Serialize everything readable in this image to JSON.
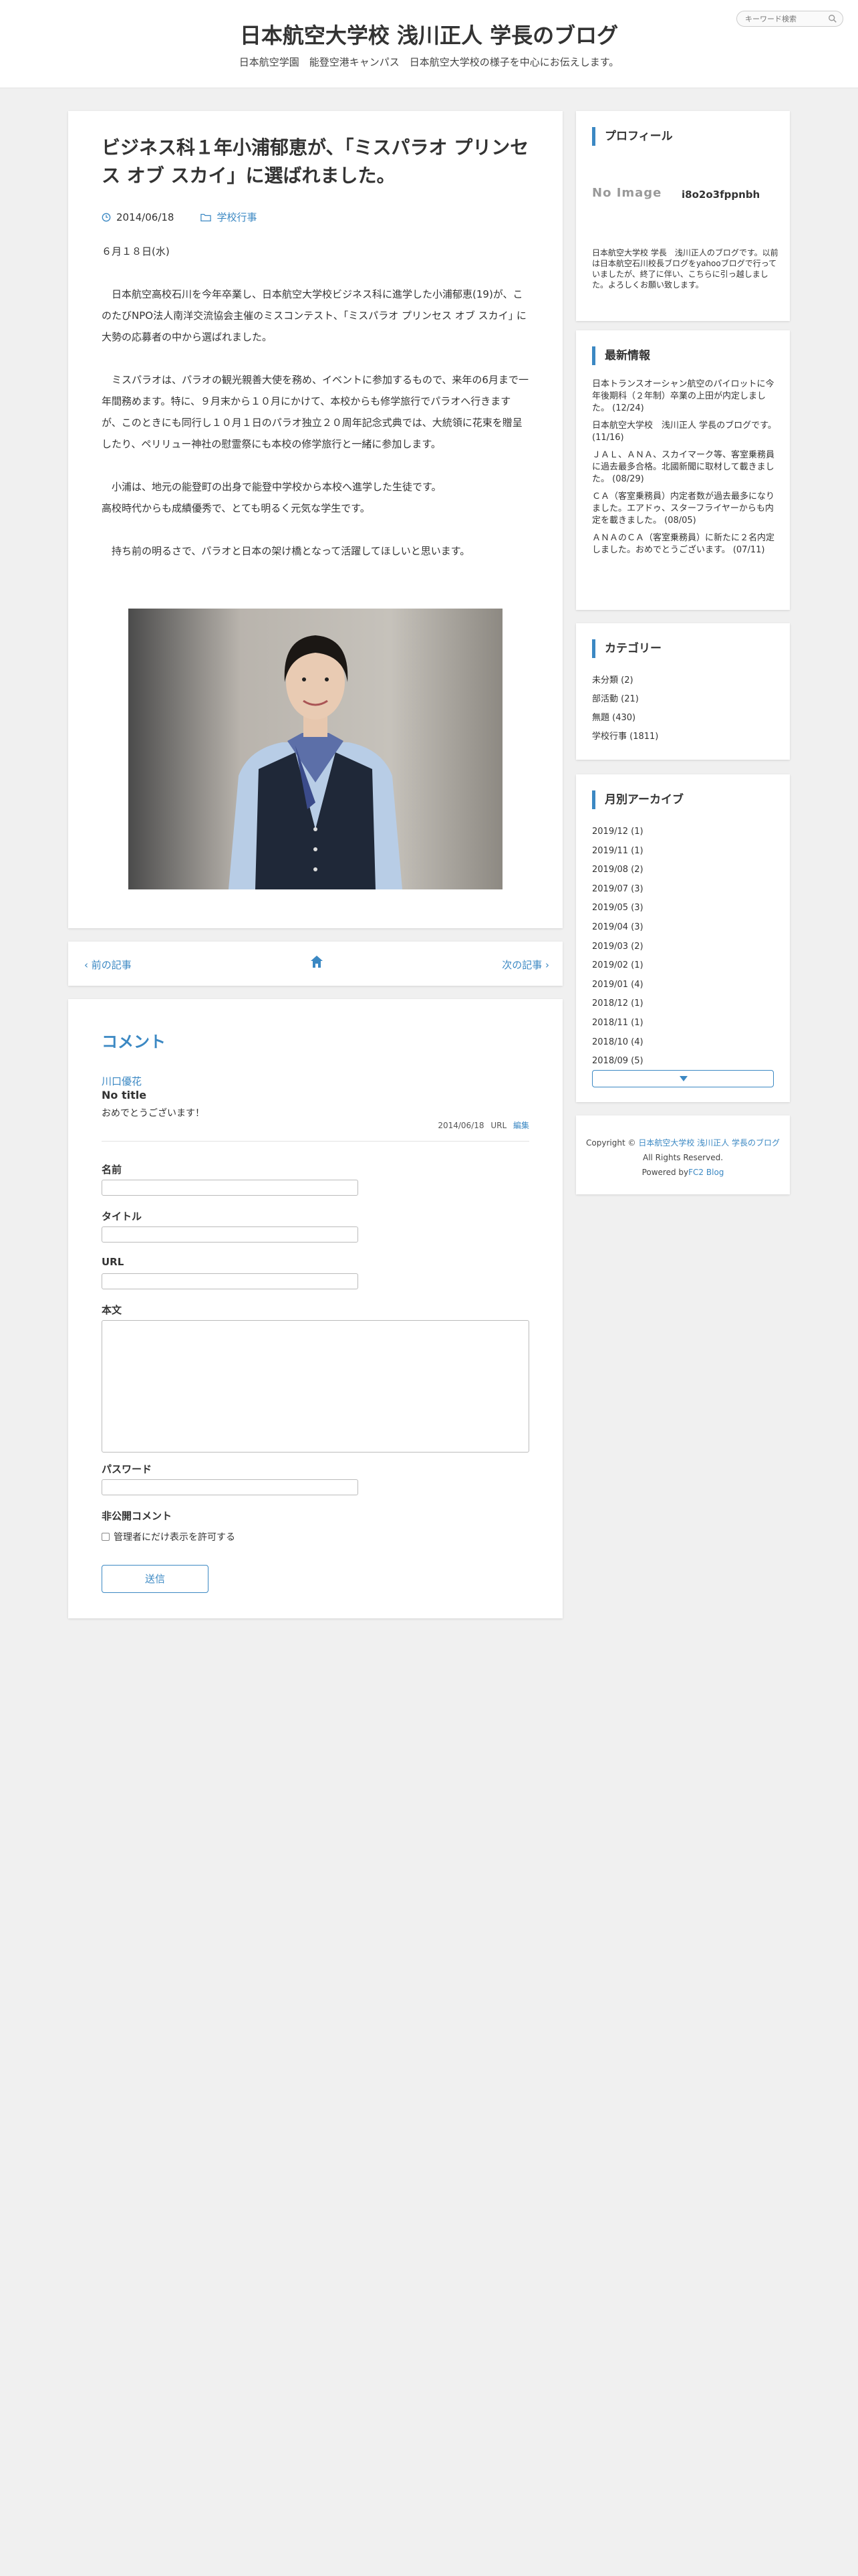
{
  "header": {
    "title": "日本航空大学校 浅川正人 学長のブログ",
    "description": "日本航空学園　能登空港キャンパス　日本航空大学校の様子を中心にお伝えします。",
    "search_placeholder": "キーワード検索"
  },
  "post": {
    "title": "ビジネス科１年小浦郁恵が、「ミスパラオ プリンセス オブ スカイ」に選ばれました。",
    "date": "2014/06/18",
    "category": "学校行事",
    "paragraphs": [
      "６月１８日(水)",
      "",
      "　日本航空高校石川を今年卒業し、日本航空大学校ビジネス科に進学した小浦郁恵(19)が、このたびNPO法人南洋交流協会主催のミスコンテスト、｢ミスパラオ プリンセス オブ スカイ｣ に大勢の応募者の中から選ばれました。",
      "",
      "　ミスパラオは、パラオの観光親善大使を務め、イベントに参加するもので、来年の6月まで一年間務めます。特に、９月末から１０月にかけて、本校からも修学旅行でパラオへ行きますが、このときにも同行し１０月１日のパラオ独立２０周年記念式典では、大統領に花束を贈呈したり、ペリリュー神社の慰霊祭にも本校の修学旅行と一緒に参加します。",
      "",
      "　小浦は、地元の能登町の出身で能登中学校から本校へ進学した生徒です。",
      "高校時代からも成績優秀で、とても明るく元気な学生です。",
      "",
      "　持ち前の明るさで、パラオと日本の架け橋となって活躍してほしいと思います。"
    ]
  },
  "nav": {
    "prev": "前の記事",
    "next": "次の記事"
  },
  "comments": {
    "heading": "コメント",
    "items": [
      {
        "author": "川口優花",
        "title": "No title",
        "body": "おめでとうございます！",
        "date": "2014/06/18",
        "url_label": "URL",
        "edit_label": "編集"
      }
    ],
    "form": {
      "name_label": "名前",
      "title_label": "タイトル",
      "url_label": "URL",
      "body_label": "本文",
      "password_label": "パスワード",
      "private_label": "非公開コメント",
      "private_option": "管理者にだけ表示を許可する",
      "submit_label": "送信"
    }
  },
  "sidebar": {
    "profile": {
      "heading": "プロフィール",
      "no_image": "No Image",
      "name": "i8o2o3fppnbh",
      "description": "日本航空大学校 学長　浅川正人のブログです。以前は日本航空石川校長ブログをyahooブログで行っていましたが、終了に伴い、こちらに引っ越しました。よろしくお願い致します。"
    },
    "news": {
      "heading": "最新情報",
      "items": [
        "日本トランスオーシャン航空のパイロットに今年後期科（２年制）卒業の上田が内定しました。 (12/24)",
        "日本航空大学校　浅川正人 学長のブログです。 (11/16)",
        "ＪＡＬ、ＡＮＡ、スカイマーク等、客室乗務員に過去最多合格。北國新聞に取材して載きました。 (08/29)",
        "ＣＡ（客室乗務員）内定者数が過去最多になりました。エアドゥ、スターフライヤーからも内定を載きました。 (08/05)",
        "ＡＮＡのＣＡ（客室乗務員）に新たに２名内定しました。おめでとうございます。 (07/11)"
      ]
    },
    "categories": {
      "heading": "カテゴリー",
      "items": [
        "未分類 (2)",
        "部活動 (21)",
        "無題 (430)",
        "学校行事 (1811)"
      ]
    },
    "archives": {
      "heading": "月別アーカイブ",
      "items": [
        "2019/12 (1)",
        "2019/11 (1)",
        "2019/08 (2)",
        "2019/07 (3)",
        "2019/05 (3)",
        "2019/04 (3)",
        "2019/03 (2)",
        "2019/02 (1)",
        "2019/01 (4)",
        "2018/12 (1)",
        "2018/11 (1)",
        "2018/10 (4)",
        "2018/09 (5)"
      ]
    },
    "footer": {
      "copyright_prefix": "Copyright ©",
      "copyright_link": "日本航空大学校 浅川正人 学長のブログ",
      "rights": "All Rights Reserved.",
      "powered_prefix": "Powered by",
      "powered_link": "FC2 Blog"
    }
  }
}
